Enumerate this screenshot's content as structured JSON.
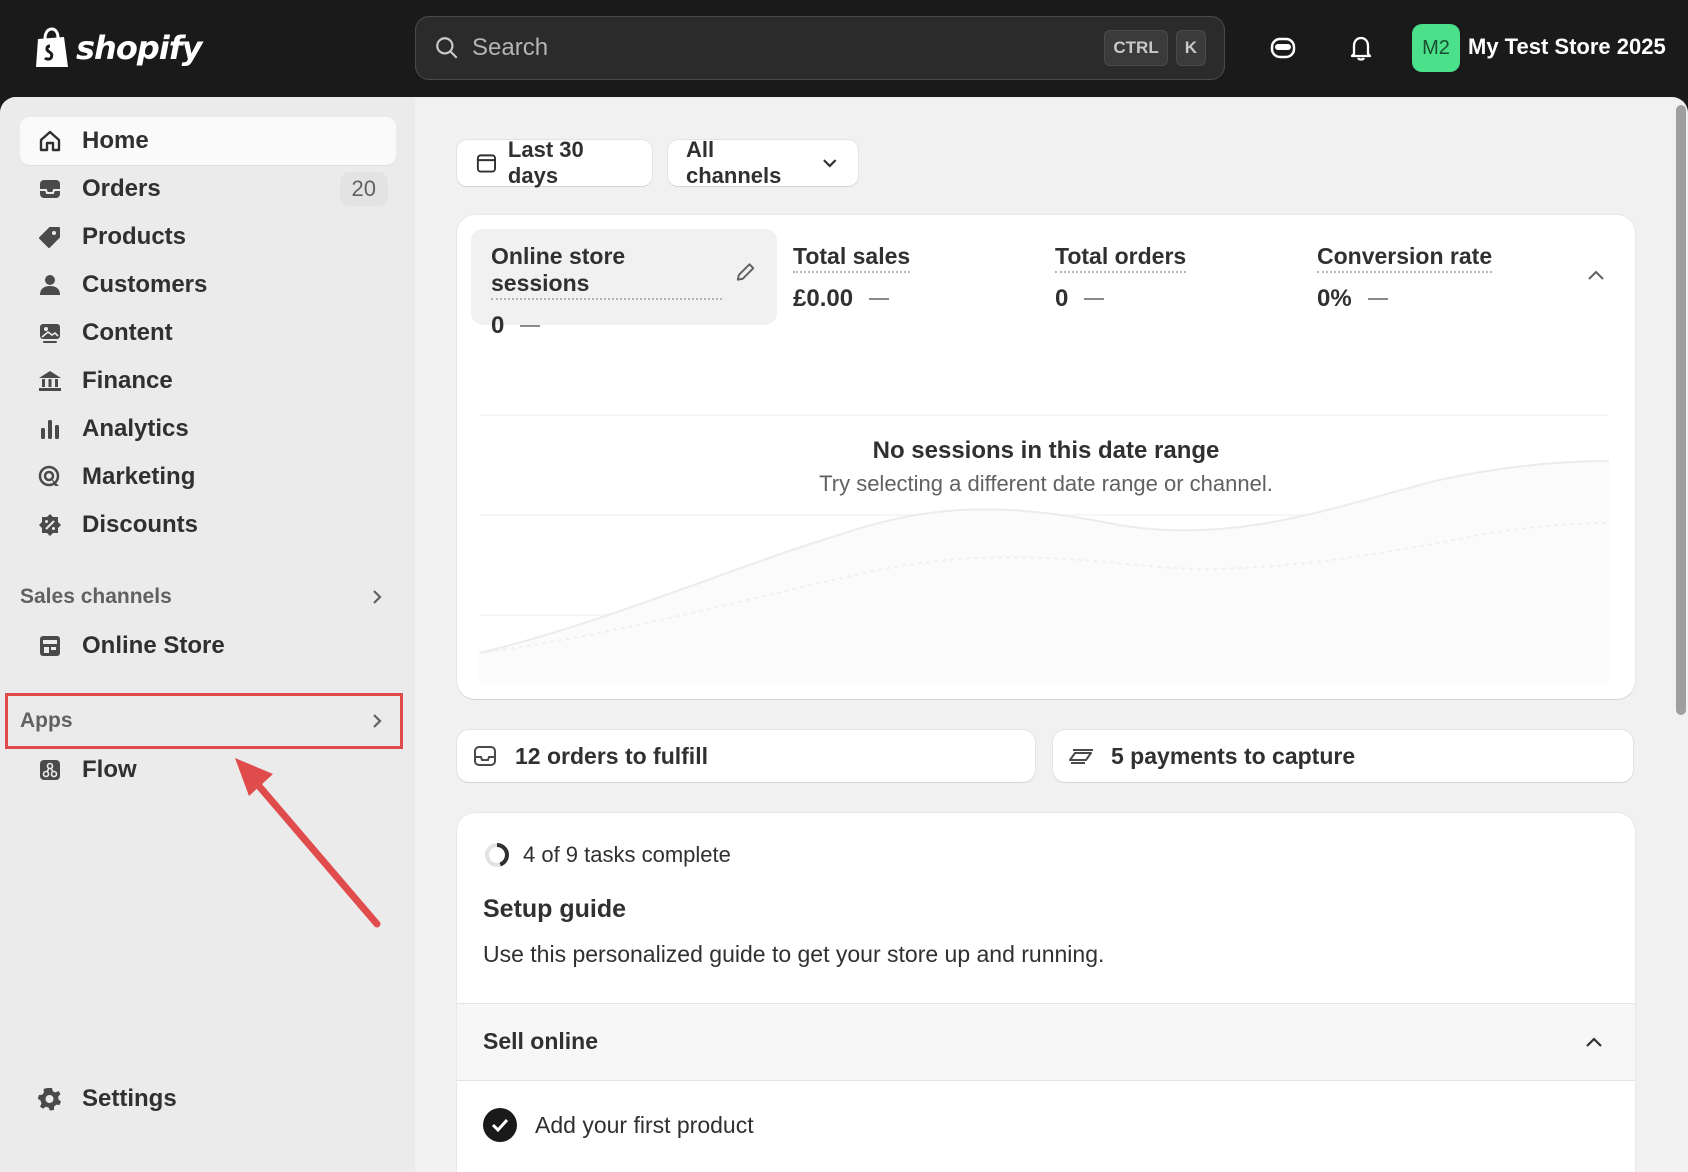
{
  "topbar": {
    "brand": "shopify",
    "search_placeholder": "Search",
    "shortcut_ctrl": "CTRL",
    "shortcut_k": "K",
    "avatar_initials": "M2",
    "store_name": "My Test Store 2025"
  },
  "sidebar": {
    "items": [
      {
        "label": "Home",
        "icon": "home-icon"
      },
      {
        "label": "Orders",
        "icon": "inbox-icon",
        "badge": "20"
      },
      {
        "label": "Products",
        "icon": "tag-icon"
      },
      {
        "label": "Customers",
        "icon": "person-icon"
      },
      {
        "label": "Content",
        "icon": "image-icon"
      },
      {
        "label": "Finance",
        "icon": "bank-icon"
      },
      {
        "label": "Analytics",
        "icon": "bar-chart-icon"
      },
      {
        "label": "Marketing",
        "icon": "target-icon"
      },
      {
        "label": "Discounts",
        "icon": "discount-icon"
      }
    ],
    "sales_channels": "Sales channels",
    "online_store": "Online Store",
    "apps": "Apps",
    "flow": "Flow",
    "settings": "Settings"
  },
  "filters": {
    "date_range": "Last 30 days",
    "channels": "All channels"
  },
  "metrics": [
    {
      "title": "Online store sessions",
      "value": "0"
    },
    {
      "title": "Total sales",
      "value": "£0.00"
    },
    {
      "title": "Total orders",
      "value": "0"
    },
    {
      "title": "Conversion rate",
      "value": "0%"
    }
  ],
  "empty_state": {
    "title": "No sessions in this date range",
    "subtitle": "Try selecting a different date range or channel."
  },
  "actions": {
    "orders_to_fulfill": "12 orders to fulfill",
    "payments_to_capture": "5 payments to capture"
  },
  "setup": {
    "progress": "4 of 9 tasks complete",
    "tasks_complete": 4,
    "tasks_total": 9,
    "title": "Setup guide",
    "description": "Use this personalized guide to get your store up and running.",
    "section": "Sell online",
    "first_task": "Add your first product"
  },
  "colors": {
    "highlight": "#e04b4b",
    "avatar": "#4be18a"
  }
}
